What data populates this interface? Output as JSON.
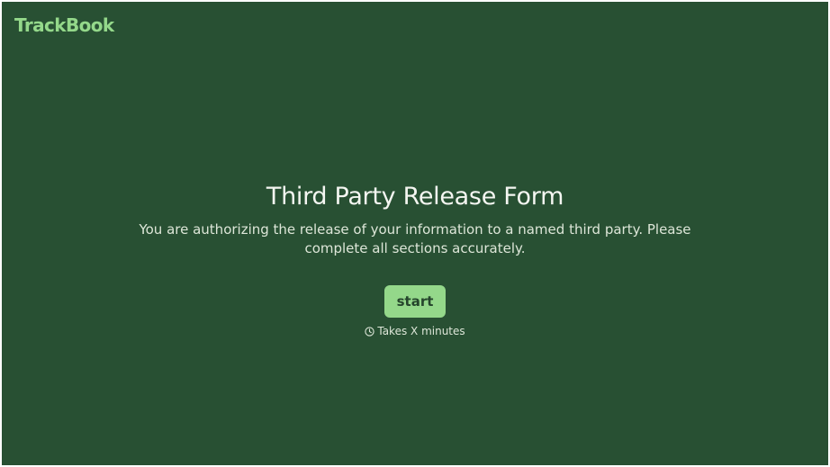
{
  "header": {
    "logo_text": "TrackBook"
  },
  "main": {
    "title": "Third Party Release Form",
    "description": "You are authorizing the release of your information to a named third party. Please complete all sections accurately.",
    "start_label": "start",
    "duration_icon": "clock-icon",
    "duration_text": "Takes X minutes"
  },
  "colors": {
    "background": "#285033",
    "accent": "#94d88a",
    "button_text": "#25452c",
    "title": "#f4f6f1",
    "body_text": "#dde6d8"
  }
}
